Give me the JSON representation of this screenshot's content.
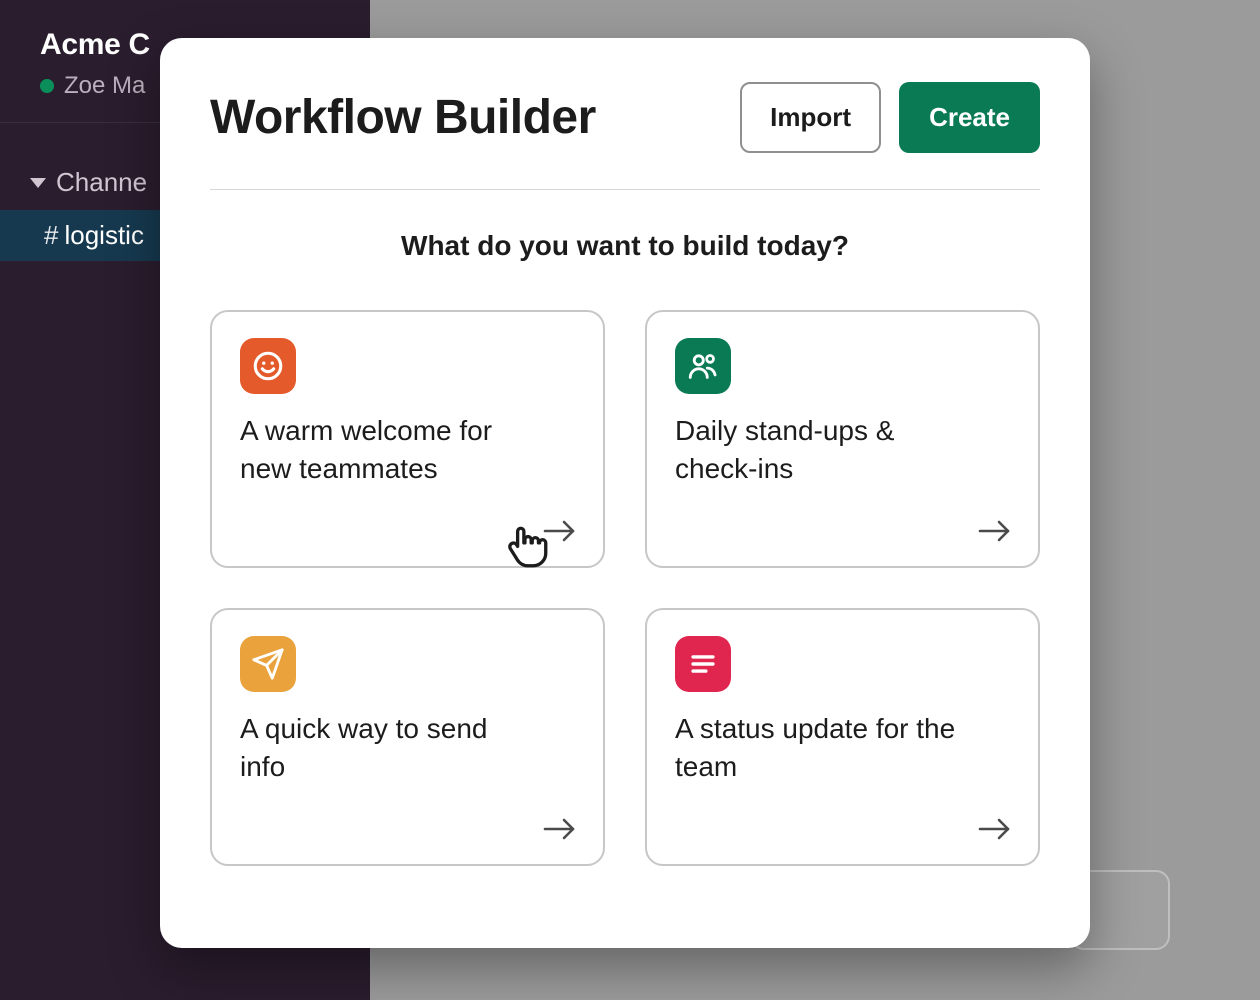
{
  "sidebar": {
    "workspace_name": "Acme C",
    "username": "Zoe Ma",
    "channels_label": "Channe",
    "channel_items": [
      {
        "name": "logistic"
      }
    ]
  },
  "modal": {
    "title": "Workflow Builder",
    "import_label": "Import",
    "create_label": "Create",
    "prompt": "What do you want to build today?",
    "cards": [
      {
        "title": "A warm welcome for new teammates",
        "icon": "smile-icon",
        "color": "orange"
      },
      {
        "title": "Daily stand-ups & check-ins",
        "icon": "people-icon",
        "color": "green"
      },
      {
        "title": "A quick way to send info",
        "icon": "paper-plane-icon",
        "color": "amber"
      },
      {
        "title": "A status update for the team",
        "icon": "lines-icon",
        "color": "pink"
      }
    ]
  },
  "colors": {
    "sidebar_bg": "#2a1d2e",
    "channel_selected_bg": "#16394f",
    "primary_green": "#0a7a55",
    "card_orange": "#e45a2b",
    "card_amber": "#e9a23c",
    "card_pink": "#e0264f"
  }
}
